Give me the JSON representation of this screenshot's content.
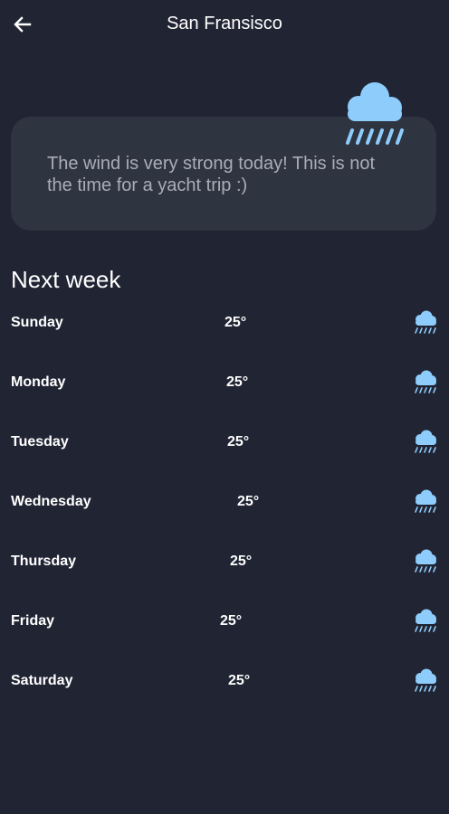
{
  "header": {
    "title": "San Fransisco",
    "back_icon": "arrow-left-icon"
  },
  "card": {
    "message": "The wind is very strong today! This is not the time for a yacht trip :)",
    "icon": "rain-cloud-icon"
  },
  "forecast": {
    "title": "Next week",
    "days": [
      {
        "day": "Sunday",
        "temp": "25°",
        "icon": "rain-cloud-icon"
      },
      {
        "day": "Monday",
        "temp": "25°",
        "icon": "rain-cloud-icon"
      },
      {
        "day": "Tuesday",
        "temp": "25°",
        "icon": "rain-cloud-icon"
      },
      {
        "day": "Wednesday",
        "temp": "25°",
        "icon": "rain-cloud-icon"
      },
      {
        "day": "Thursday",
        "temp": "25°",
        "icon": "rain-cloud-icon"
      },
      {
        "day": "Friday",
        "temp": "25°",
        "icon": "rain-cloud-icon"
      },
      {
        "day": "Saturday",
        "temp": "25°",
        "icon": "rain-cloud-icon"
      }
    ]
  },
  "colors": {
    "background": "#212433",
    "card": "#2f3441",
    "icon": "#8ecdfb",
    "card_text": "#a9adb7"
  }
}
